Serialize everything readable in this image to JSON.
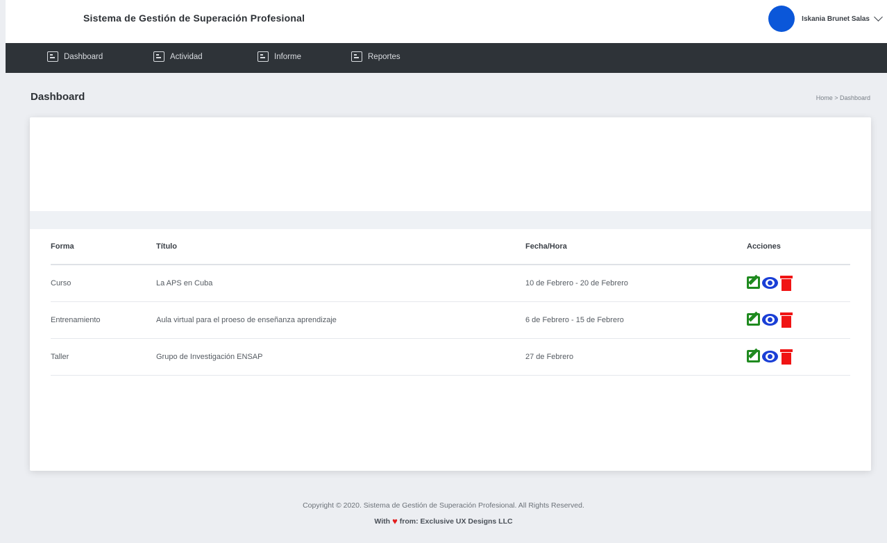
{
  "app": {
    "title": "Sistema de Gestión de Superación Profesional",
    "user_name": "Iskania Brunet Salas"
  },
  "nav": {
    "items": [
      {
        "label": "Dashboard",
        "icon": "calendar-icon"
      },
      {
        "label": "Actividad",
        "icon": "calendar-icon"
      },
      {
        "label": "Informe",
        "icon": "calendar-icon"
      },
      {
        "label": "Reportes",
        "icon": "calendar-icon"
      }
    ]
  },
  "page": {
    "title": "Dashboard",
    "breadcrumb": "Home > Dashboard"
  },
  "table": {
    "headers": [
      "Forma",
      "Título",
      "Fecha/Hora",
      "Acciones"
    ],
    "rows": [
      {
        "forma": "Curso",
        "titulo": "La APS en Cuba",
        "fecha": "10 de Febrero - 20 de Febrero"
      },
      {
        "forma": "Entrenamiento",
        "titulo": "Aula virtual para el proeso de enseñanza aprendizaje",
        "fecha": "6 de Febrero - 15 de Febrero"
      },
      {
        "forma": "Taller",
        "titulo": "Grupo de Investigación ENSAP",
        "fecha": "27 de Febrero"
      }
    ]
  },
  "footer": {
    "copyright": "Copyright © 2020. Sistema de Gestión de Superación Profesional. All Rights Reserved.",
    "with": "With",
    "from": "from: Exclusive UX Designs LLC"
  },
  "colors": {
    "navbar": "#2e3338",
    "avatar": "#0b57d9",
    "edit": "#1f8a1f",
    "view": "#1a3fd6",
    "delete": "#f01414"
  }
}
